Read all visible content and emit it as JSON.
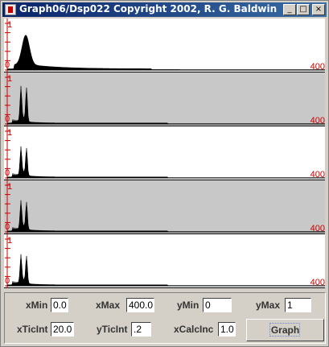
{
  "window": {
    "title": "Graph06/Dsp022 Copyright 2002, R. G. Baldwin",
    "minimize_label": "_",
    "maximize_label": "□",
    "close_label": "×"
  },
  "plots": {
    "y_top_label": "1",
    "y_zero_label": "0",
    "x_max_label": "400",
    "items": [
      {
        "background": "#ffffff",
        "name": "plot-1"
      },
      {
        "background": "#c8c8c8",
        "name": "plot-2"
      },
      {
        "background": "#ffffff",
        "name": "plot-3"
      },
      {
        "background": "#c8c8c8",
        "name": "plot-4"
      },
      {
        "background": "#ffffff",
        "name": "plot-5"
      }
    ]
  },
  "controls": {
    "xMin": {
      "label": "xMin",
      "value": "0.0"
    },
    "xMax": {
      "label": "xMax",
      "value": "400.0"
    },
    "yMin": {
      "label": "yMin",
      "value": "0"
    },
    "yMax": {
      "label": "yMax",
      "value": "1"
    },
    "xTicInt": {
      "label": "xTicInt",
      "value": "20.0"
    },
    "yTicInt": {
      "label": "yTicInt",
      "value": ".2"
    },
    "xCalcInc": {
      "label": "xCalcInc",
      "value": "1.0"
    },
    "graph_button": "Graph"
  },
  "colors": {
    "axis_label": "#cc0000",
    "plot_alt_bg": "#c8c8c8",
    "title_bar": "#0a246a"
  }
}
